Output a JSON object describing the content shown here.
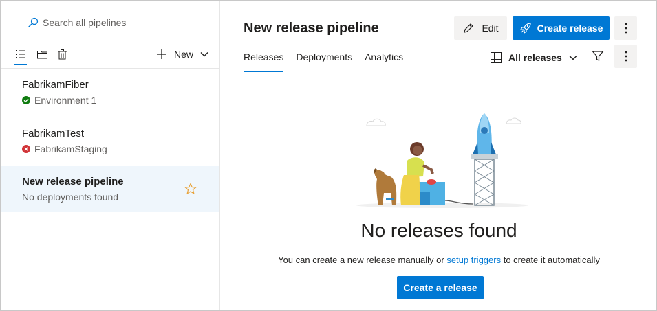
{
  "sidebar": {
    "search_placeholder": "Search all pipelines",
    "new_label": "New",
    "pipelines": [
      {
        "name": "FabrikamFiber",
        "status": "Environment 1",
        "state": "success"
      },
      {
        "name": "FabrikamTest",
        "status": "FabrikamStaging",
        "state": "failed"
      },
      {
        "name": "New release pipeline",
        "status": "No deployments found",
        "state": "none",
        "selected": true,
        "favorite": true
      }
    ]
  },
  "header": {
    "title": "New release pipeline",
    "edit_label": "Edit",
    "create_release_label": "Create release"
  },
  "tabs": [
    {
      "label": "Releases",
      "active": true
    },
    {
      "label": "Deployments",
      "active": false
    },
    {
      "label": "Analytics",
      "active": false
    }
  ],
  "filter": {
    "selected": "All releases"
  },
  "empty_state": {
    "title": "No releases found",
    "desc_before": "You can create a new release manually or ",
    "desc_link": "setup triggers",
    "desc_after": " to create it automatically",
    "button_label": "Create a release"
  },
  "colors": {
    "accent": "#0078d4",
    "success": "#107c10",
    "error": "#d13438",
    "favorite": "#e8a33b",
    "selected_bg": "#eff6fc"
  }
}
